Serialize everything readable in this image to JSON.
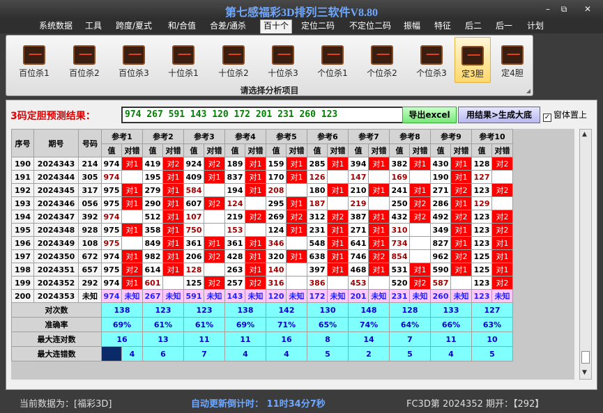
{
  "window": {
    "title": "第七感福彩3D排列三软件V8.80",
    "minimize": "–",
    "restore": "⧉",
    "close": "✕"
  },
  "menu": [
    "系统数据",
    "工具",
    "跨度/夏式",
    "和/合值",
    "合差/通杀",
    "百十个",
    "定位二码",
    "不定位二码",
    "振幅",
    "特征",
    "后二",
    "后一",
    "计划"
  ],
  "menu_active": 5,
  "toolbar": {
    "items": [
      "百位杀1",
      "百位杀2",
      "百位杀3",
      "十位杀1",
      "十位杀2",
      "十位杀3",
      "个位杀1",
      "个位杀2",
      "个位杀3",
      "定3胆",
      "定4胆"
    ],
    "active": 9,
    "caption": "请选择分析项目"
  },
  "prediction": {
    "label": "3码定胆预测结果：",
    "value": "974 267 591 143 120 172 201 231 260 123",
    "export_label": "导出excel",
    "generate_label": "用结果>生成大底",
    "ontop_label": "窗体置上",
    "ontop_checked": "✓"
  },
  "table": {
    "col_headers": [
      "序号",
      "期号",
      "号码"
    ],
    "ref_headers": [
      "参考1",
      "参考2",
      "参考3",
      "参考4",
      "参考5",
      "参考6",
      "参考7",
      "参考8",
      "参考9",
      "参考10"
    ],
    "sub_headers": [
      "值",
      "对错"
    ],
    "rows": [
      {
        "idx": "190",
        "period": "2024343",
        "code": "214",
        "cells": [
          [
            "974",
            "对1"
          ],
          [
            "419",
            "对2"
          ],
          [
            "924",
            "对2"
          ],
          [
            "189",
            "对1"
          ],
          [
            "159",
            "对1"
          ],
          [
            "285",
            "对1"
          ],
          [
            "394",
            "对1"
          ],
          [
            "382",
            "对1"
          ],
          [
            "430",
            "对1"
          ],
          [
            "128",
            "对2"
          ]
        ]
      },
      {
        "idx": "191",
        "period": "2024344",
        "code": "305",
        "cells": [
          [
            "974",
            ""
          ],
          [
            "195",
            "对1"
          ],
          [
            "409",
            "对1"
          ],
          [
            "837",
            "对1"
          ],
          [
            "170",
            "对1"
          ],
          [
            "126",
            ""
          ],
          [
            "147",
            ""
          ],
          [
            "169",
            ""
          ],
          [
            "190",
            "对1"
          ],
          [
            "127",
            ""
          ]
        ]
      },
      {
        "idx": "192",
        "period": "2024345",
        "code": "317",
        "cells": [
          [
            "975",
            "对1"
          ],
          [
            "279",
            "对1"
          ],
          [
            "584",
            ""
          ],
          [
            "194",
            "对1"
          ],
          [
            "208",
            ""
          ],
          [
            "180",
            "对1"
          ],
          [
            "210",
            "对1"
          ],
          [
            "241",
            "对1"
          ],
          [
            "271",
            "对2"
          ],
          [
            "123",
            "对2"
          ]
        ]
      },
      {
        "idx": "193",
        "period": "2024346",
        "code": "056",
        "cells": [
          [
            "975",
            "对1"
          ],
          [
            "290",
            "对1"
          ],
          [
            "607",
            "对2"
          ],
          [
            "124",
            ""
          ],
          [
            "295",
            "对1"
          ],
          [
            "187",
            ""
          ],
          [
            "219",
            ""
          ],
          [
            "250",
            "对2"
          ],
          [
            "286",
            "对1"
          ],
          [
            "129",
            ""
          ]
        ]
      },
      {
        "idx": "194",
        "period": "2024347",
        "code": "392",
        "cells": [
          [
            "974",
            ""
          ],
          [
            "512",
            "对1"
          ],
          [
            "107",
            ""
          ],
          [
            "219",
            "对2"
          ],
          [
            "269",
            "对2"
          ],
          [
            "312",
            "对2"
          ],
          [
            "387",
            "对1"
          ],
          [
            "432",
            "对2"
          ],
          [
            "492",
            "对2"
          ],
          [
            "123",
            "对2"
          ]
        ]
      },
      {
        "idx": "195",
        "period": "2024348",
        "code": "928",
        "cells": [
          [
            "975",
            "对1"
          ],
          [
            "358",
            "对1"
          ],
          [
            "750",
            ""
          ],
          [
            "153",
            ""
          ],
          [
            "124",
            "对1"
          ],
          [
            "231",
            "对1"
          ],
          [
            "271",
            "对1"
          ],
          [
            "310",
            ""
          ],
          [
            "349",
            "对1"
          ],
          [
            "123",
            "对2"
          ]
        ]
      },
      {
        "idx": "196",
        "period": "2024349",
        "code": "108",
        "cells": [
          [
            "975",
            ""
          ],
          [
            "849",
            "对1"
          ],
          [
            "361",
            "对1"
          ],
          [
            "361",
            "对1"
          ],
          [
            "346",
            ""
          ],
          [
            "548",
            "对1"
          ],
          [
            "641",
            "对1"
          ],
          [
            "734",
            ""
          ],
          [
            "827",
            "对1"
          ],
          [
            "123",
            "对1"
          ]
        ]
      },
      {
        "idx": "197",
        "period": "2024350",
        "code": "672",
        "cells": [
          [
            "974",
            "对1"
          ],
          [
            "982",
            "对1"
          ],
          [
            "206",
            "对2"
          ],
          [
            "428",
            "对1"
          ],
          [
            "320",
            "对1"
          ],
          [
            "638",
            "对1"
          ],
          [
            "746",
            "对2"
          ],
          [
            "854",
            ""
          ],
          [
            "962",
            "对2"
          ],
          [
            "125",
            "对1"
          ]
        ]
      },
      {
        "idx": "198",
        "period": "2024351",
        "code": "657",
        "cells": [
          [
            "975",
            "对2"
          ],
          [
            "614",
            "对1"
          ],
          [
            "128",
            ""
          ],
          [
            "263",
            "对1"
          ],
          [
            "140",
            ""
          ],
          [
            "397",
            "对1"
          ],
          [
            "468",
            "对1"
          ],
          [
            "531",
            "对1"
          ],
          [
            "590",
            "对1"
          ],
          [
            "125",
            "对1"
          ]
        ]
      },
      {
        "idx": "199",
        "period": "2024352",
        "code": "292",
        "cells": [
          [
            "974",
            "对1"
          ],
          [
            "601",
            ""
          ],
          [
            "125",
            "对2"
          ],
          [
            "257",
            "对2"
          ],
          [
            "316",
            ""
          ],
          [
            "386",
            ""
          ],
          [
            "453",
            ""
          ],
          [
            "520",
            "对2"
          ],
          [
            "587",
            ""
          ],
          [
            "123",
            "对2"
          ]
        ]
      }
    ],
    "pred_row": {
      "idx": "200",
      "period": "2024353",
      "code": "未知",
      "values": [
        "974",
        "267",
        "591",
        "143",
        "120",
        "172",
        "201",
        "231",
        "260",
        "123"
      ],
      "status": "未知"
    },
    "stats": [
      {
        "label": "对次数",
        "values": [
          "138",
          "123",
          "123",
          "138",
          "142",
          "130",
          "148",
          "128",
          "133",
          "127"
        ]
      },
      {
        "label": "准确率",
        "values": [
          "69%",
          "61%",
          "61%",
          "69%",
          "71%",
          "65%",
          "74%",
          "64%",
          "66%",
          "63%"
        ]
      },
      {
        "label": "最大连对数",
        "values": [
          "16",
          "13",
          "11",
          "11",
          "16",
          "8",
          "14",
          "7",
          "11",
          "10"
        ]
      },
      {
        "label": "最大连错数",
        "values": [
          "4",
          "6",
          "7",
          "4",
          "4",
          "5",
          "2",
          "5",
          "4",
          "5"
        ]
      }
    ]
  },
  "status": {
    "current_data": "当前数据为：[福彩3D]",
    "countdown": "自动更新倒计时：  11时34分7秒",
    "draw": "FC3D第 2024352 期开：【292】"
  },
  "colors": {
    "hit": "#ff0000",
    "miss_text": "#a00000",
    "pred_row": "#ffc8ff",
    "stats": "#80ffff",
    "prediction_text": "#008000"
  }
}
